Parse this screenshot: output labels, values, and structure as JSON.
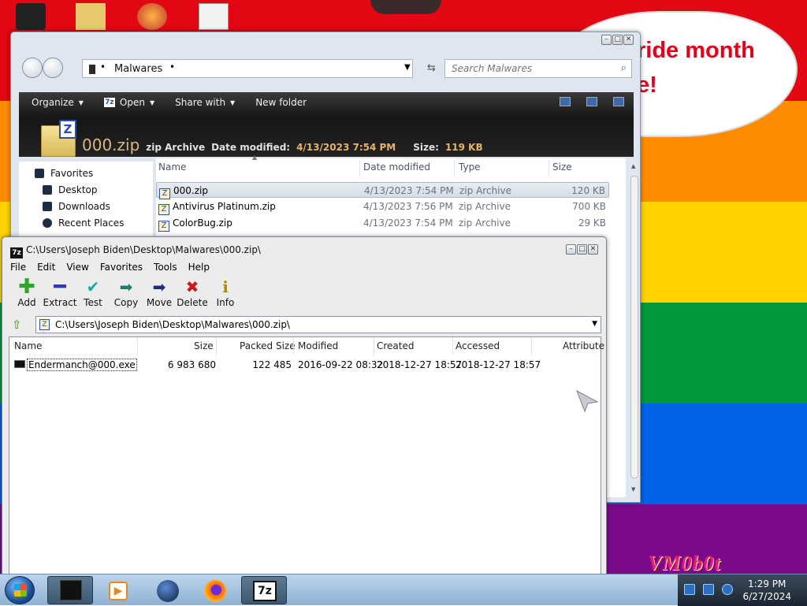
{
  "desktop": {
    "speech_text": "ride month\ne!",
    "watermark": "VM0b0t"
  },
  "colors": {
    "rainbow": [
      "#e30613",
      "#ff8c00",
      "#ffd200",
      "#009a3b",
      "#0063e8",
      "#7a0a8a"
    ],
    "speech_text": "#e2001a",
    "watermark": "#e8187c"
  },
  "explorer": {
    "current_folder": "Malwares",
    "search_placeholder": "Search Malwares",
    "toolbar": {
      "organize": "Organize",
      "open": "Open",
      "share_with": "Share with",
      "new_folder": "New folder"
    },
    "details": {
      "name": "000.zip",
      "type": "zip Archive",
      "date_label": "Date modified:",
      "date_value": "4/13/2023 7:54 PM",
      "size_label": "Size:",
      "size_value": "119 KB"
    },
    "nav": {
      "favorites": "Favorites",
      "desktop": "Desktop",
      "downloads": "Downloads",
      "recent_places": "Recent Places"
    },
    "columns": {
      "name": "Name",
      "date_modified": "Date modified",
      "type": "Type",
      "size": "Size"
    },
    "files": [
      {
        "name": "000.zip",
        "date": "4/13/2023 7:54 PM",
        "type": "zip Archive",
        "size": "120 KB"
      },
      {
        "name": "Antivirus Platinum.zip",
        "date": "4/13/2023 7:56 PM",
        "type": "zip Archive",
        "size": "700 KB"
      },
      {
        "name": "ColorBug.zip",
        "date": "4/13/2023 7:54 PM",
        "type": "zip Archive",
        "size": "29 KB"
      }
    ]
  },
  "sevenzip": {
    "title": "C:\\Users\\Joseph Biden\\Desktop\\Malwares\\000.zip\\",
    "menu": [
      "File",
      "Edit",
      "View",
      "Favorites",
      "Tools",
      "Help"
    ],
    "tools": [
      "Add",
      "Extract",
      "Test",
      "Copy",
      "Move",
      "Delete",
      "Info"
    ],
    "path": "C:\\Users\\Joseph Biden\\Desktop\\Malwares\\000.zip\\",
    "columns": {
      "name": "Name",
      "size": "Size",
      "packed_size": "Packed Size",
      "modified": "Modified",
      "created": "Created",
      "accessed": "Accessed",
      "attributes": "Attribute"
    },
    "rows": [
      {
        "name": "Endermanch@000.exe",
        "size": "6 983 680",
        "packed_size": "122 485",
        "modified": "2016-09-22 08:32",
        "created": "2018-12-27 18:57",
        "accessed": "2018-12-27 18:57"
      }
    ]
  },
  "taskbar": {
    "time": "1:29 PM",
    "date": "6/27/2024",
    "seven_zip_label": "7z"
  }
}
